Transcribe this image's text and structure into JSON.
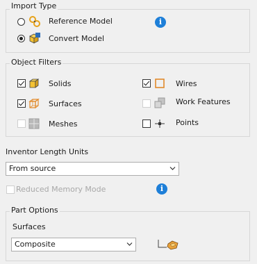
{
  "import_type": {
    "title": "Import Type",
    "options": [
      {
        "label": "Reference Model",
        "selected": false
      },
      {
        "label": "Convert Model",
        "selected": true
      }
    ],
    "info_icon": "i"
  },
  "object_filters": {
    "title": "Object Filters",
    "items": {
      "solids": {
        "label": "Solids",
        "checked": true
      },
      "surfaces": {
        "label": "Surfaces",
        "checked": true
      },
      "meshes": {
        "label": "Meshes",
        "checked": false,
        "disabled": true
      },
      "wires": {
        "label": "Wires",
        "checked": true
      },
      "work_features": {
        "label": "Work Features",
        "checked": false,
        "disabled": true
      },
      "points": {
        "label": "Points",
        "checked": false
      }
    }
  },
  "length_units": {
    "label": "Inventor Length Units",
    "selected": "From source"
  },
  "reduced_memory": {
    "label": "Reduced Memory Mode",
    "checked": false,
    "disabled": true,
    "info_icon": "i"
  },
  "part_options": {
    "title": "Part Options",
    "surfaces_label": "Surfaces",
    "surfaces_selected": "Composite"
  },
  "colors": {
    "background": "#f0f0f0",
    "group_border": "#d7d7d7",
    "info_blue": "#1e7fd8",
    "icon_orange": "#e28a2b",
    "icon_yellow": "#f4c233",
    "disabled_text": "#a8a8a8"
  }
}
